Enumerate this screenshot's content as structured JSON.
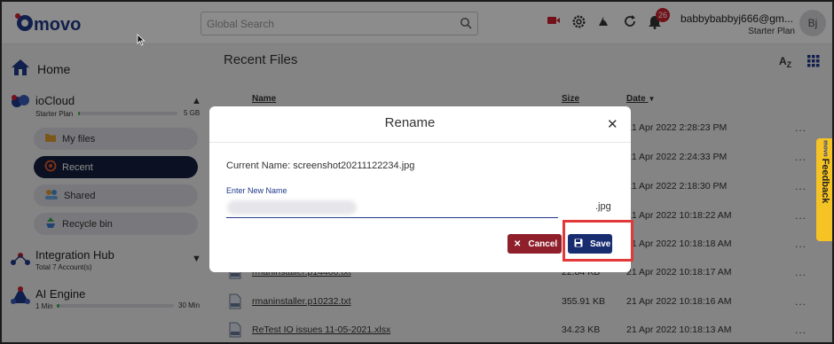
{
  "app": {
    "brand": "movo"
  },
  "header": {
    "search_placeholder": "Global Search",
    "notification_count": "26",
    "user_email": "babbybabbyj666@gm...",
    "user_plan": "Starter Plan",
    "avatar_initials": "Bj"
  },
  "sidebar": {
    "home_label": "Home",
    "iocloud": {
      "title": "ioCloud",
      "plan": "Starter Plan",
      "storage_limit": "5 GB",
      "usage_fraction": 0.02
    },
    "items": [
      {
        "label": "My files",
        "icon": "folder-icon",
        "active": false
      },
      {
        "label": "Recent",
        "icon": "recent-icon",
        "active": true
      },
      {
        "label": "Shared",
        "icon": "shared-icon",
        "active": false
      },
      {
        "label": "Recycle bin",
        "icon": "recycle-icon",
        "active": false
      }
    ],
    "integration_hub": {
      "title": "Integration Hub",
      "subtitle": "Total 7 Account(s)"
    },
    "ai_engine": {
      "title": "AI Engine",
      "min_label": "1 Min",
      "max_label": "30 Min",
      "usage_fraction": 0.02
    }
  },
  "main": {
    "title": "Recent Files",
    "sort_label": "A-Z",
    "columns": {
      "name": "Name",
      "size": "Size",
      "date": "Date"
    },
    "dates": [
      "21 Apr 2022 2:28:23 PM",
      "21 Apr 2022 2:24:33 PM",
      "21 Apr 2022 2:18:30 PM",
      "21 Apr 2022 10:18:22 AM",
      "21 Apr 2022 10:18:18 AM",
      "21 Apr 2022 10:18:17 AM",
      "21 Apr 2022 10:18:16 AM",
      "21 Apr 2022 10:18:13 AM"
    ],
    "visible_files": [
      {
        "name": "rmaninstaller.p14400.txt",
        "size": "22.84 KB"
      },
      {
        "name": "rmaninstaller.p10232.txt",
        "size": "355.91 KB"
      },
      {
        "name": "ReTest IO issues 11-05-2021.xlsx",
        "size": "34.23 KB"
      }
    ],
    "row_menu": "..."
  },
  "feedback": {
    "label": "Feedback",
    "brand": "movo"
  },
  "modal": {
    "title": "Rename",
    "current_name": "Current Name: screenshot20211122234.jpg",
    "field_label": "Enter New Name",
    "extension": ".jpg",
    "cancel_label": "Cancel",
    "save_label": "Save"
  },
  "colors": {
    "brand_navy": "#15203f",
    "save_blue": "#172d70",
    "cancel_red": "#8e1f2b",
    "highlight_red": "#e2383a",
    "feedback_yellow": "#f6c325",
    "progress_green": "#3caa52"
  }
}
